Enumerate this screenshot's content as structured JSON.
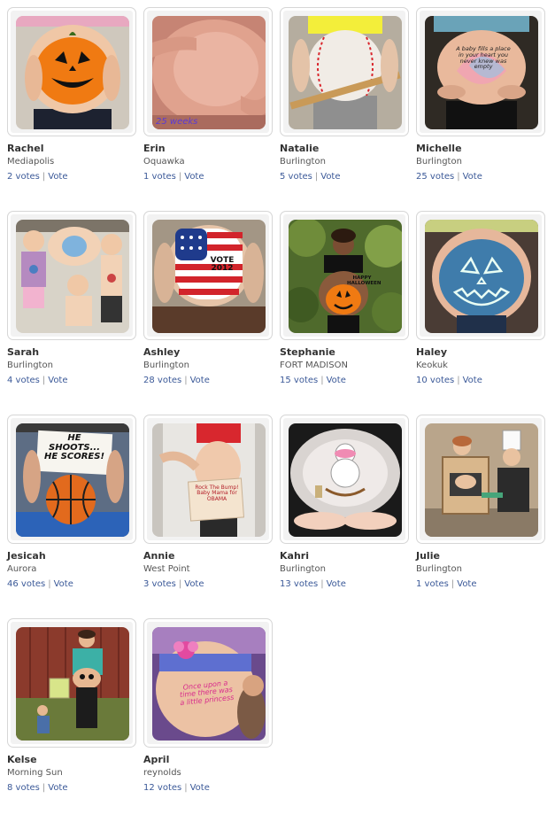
{
  "entries": [
    {
      "name": "Rachel",
      "town": "Mediapolis",
      "votes": "2 votes",
      "vote_label": "Vote",
      "separator": "|",
      "photo": "pumpkin-belly-photo"
    },
    {
      "name": "Erin",
      "town": "Oquawka",
      "votes": "1 votes",
      "vote_label": "Vote",
      "separator": "|",
      "photo": "bare-belly-photo",
      "photo_caption": "25 weeks"
    },
    {
      "name": "Natalie",
      "town": "Burlington",
      "votes": "5 votes",
      "vote_label": "Vote",
      "separator": "|",
      "photo": "baseball-belly-photo"
    },
    {
      "name": "Michelle",
      "town": "Burlington",
      "votes": "25 votes",
      "vote_label": "Vote",
      "separator": "|",
      "photo": "heart-quote-belly-photo",
      "photo_caption": "A baby fills a place in your heart you never knew was empty"
    },
    {
      "name": "Sarah",
      "town": "Burlington",
      "votes": "4 votes",
      "vote_label": "Vote",
      "separator": "|",
      "photo": "family-painted-bellies-photo"
    },
    {
      "name": "Ashley",
      "town": "Burlington",
      "votes": "28 votes",
      "vote_label": "Vote",
      "separator": "|",
      "photo": "flag-vote-belly-photo",
      "photo_caption": "VOTE 2012"
    },
    {
      "name": "Stephanie",
      "town": "FORT MADISON",
      "votes": "15 votes",
      "vote_label": "Vote",
      "separator": "|",
      "photo": "halloween-pumpkin-belly-photo",
      "photo_caption": "HAPPY HALLOWEEN"
    },
    {
      "name": "Haley",
      "town": "Keokuk",
      "votes": "10 votes",
      "vote_label": "Vote",
      "separator": "|",
      "photo": "blue-jack-o-lantern-belly-photo"
    },
    {
      "name": "Jesicah",
      "town": "Aurora",
      "votes": "46 votes",
      "vote_label": "Vote",
      "separator": "|",
      "photo": "basketball-belly-photo",
      "photo_caption": "HE SHOOTS... HE SCORES!"
    },
    {
      "name": "Annie",
      "town": "West Point",
      "votes": "3 votes",
      "vote_label": "Vote",
      "separator": "|",
      "photo": "obama-sign-belly-photo",
      "photo_caption": "Rock The Bump! Baby Mama for OBAMA"
    },
    {
      "name": "Kahri",
      "town": "Burlington",
      "votes": "13 votes",
      "vote_label": "Vote",
      "separator": "|",
      "photo": "snowman-belly-photo"
    },
    {
      "name": "Julie",
      "town": "Burlington",
      "votes": "1 votes",
      "vote_label": "Vote",
      "separator": "|",
      "photo": "oven-costume-photo"
    },
    {
      "name": "Kelse",
      "town": "Morning Sun",
      "votes": "8 votes",
      "vote_label": "Vote",
      "separator": "|",
      "photo": "outdoor-family-belly-photo"
    },
    {
      "name": "April",
      "town": "reynolds",
      "votes": "12 votes",
      "vote_label": "Vote",
      "separator": "|",
      "photo": "once-upon-a-time-belly-photo",
      "photo_caption": "Once upon a time there was a little princess"
    }
  ],
  "colors": {
    "link": "#3b5998",
    "name": "#333333",
    "town": "#555555",
    "frame_border": "#d6d6d6"
  }
}
